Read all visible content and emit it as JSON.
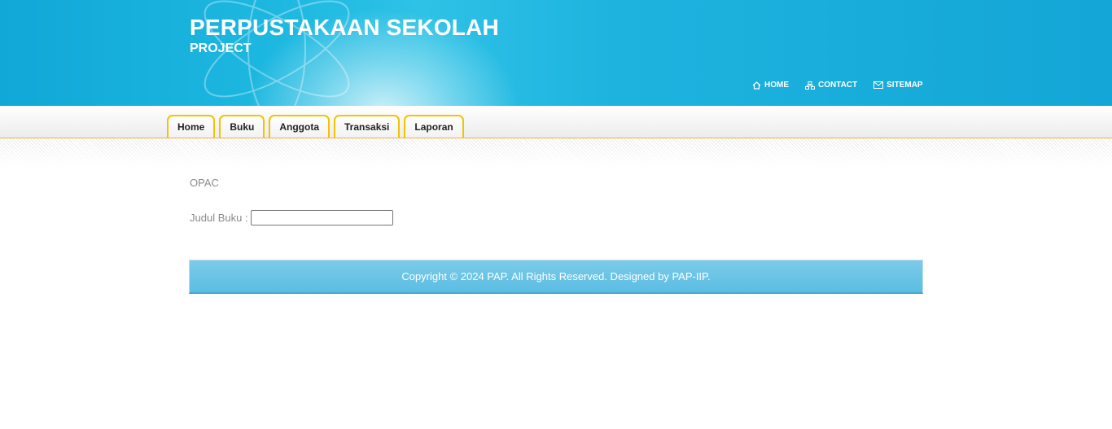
{
  "header": {
    "title": "PERPUSTAKAAN SEKOLAH",
    "subtitle": "PROJECT",
    "links": [
      {
        "label": "HOME",
        "icon": "home-icon"
      },
      {
        "label": "CONTACT",
        "icon": "contact-icon"
      },
      {
        "label": "SITEMAP",
        "icon": "mail-icon"
      }
    ]
  },
  "nav": {
    "tabs": [
      {
        "label": "Home"
      },
      {
        "label": "Buku"
      },
      {
        "label": "Anggota"
      },
      {
        "label": "Transaksi"
      },
      {
        "label": "Laporan"
      }
    ]
  },
  "main": {
    "section_title": "OPAC",
    "search": {
      "label": "Judul Buku :",
      "value": "",
      "placeholder": ""
    }
  },
  "footer": {
    "text": "Copyright © 2024 PAP. All Rights Reserved. Designed by PAP-IIP."
  },
  "colors": {
    "header_blue": "#13a6d6",
    "tab_border": "#f2c300",
    "footer_blue": "#5bbde3",
    "muted_text": "#8a8a8a"
  }
}
